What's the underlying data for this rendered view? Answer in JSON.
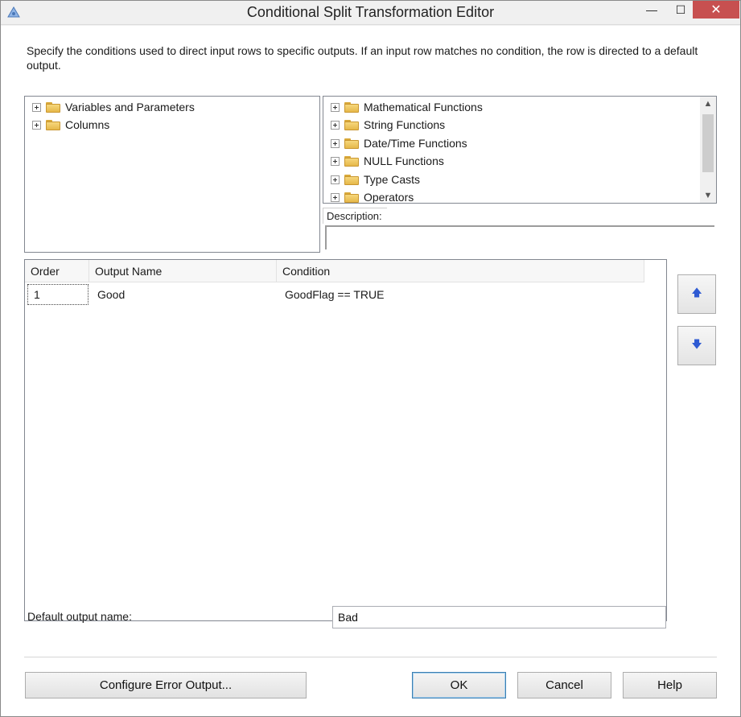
{
  "window": {
    "title": "Conditional Split Transformation Editor",
    "controls": {
      "minimize": "—",
      "maximize": "☐",
      "close": "✕"
    }
  },
  "instructions": "Specify the conditions used to direct input rows to specific outputs. If an input row matches no condition, the row is directed to a default output.",
  "left_tree": {
    "items": [
      {
        "label": "Variables and Parameters",
        "icon": "folder-icon"
      },
      {
        "label": "Columns",
        "icon": "folder-icon"
      }
    ]
  },
  "right_tree": {
    "items": [
      {
        "label": "Mathematical Functions",
        "icon": "folder-icon"
      },
      {
        "label": "String Functions",
        "icon": "folder-icon"
      },
      {
        "label": "Date/Time Functions",
        "icon": "folder-icon"
      },
      {
        "label": "NULL Functions",
        "icon": "folder-icon"
      },
      {
        "label": "Type Casts",
        "icon": "folder-icon"
      },
      {
        "label": "Operators",
        "icon": "folder-icon"
      }
    ]
  },
  "description": {
    "label": "Description:",
    "value": ""
  },
  "grid": {
    "columns": [
      "Order",
      "Output Name",
      "Condition"
    ],
    "rows": [
      {
        "order": "1",
        "output_name": "Good",
        "condition": "GoodFlag ==  TRUE"
      }
    ]
  },
  "default_output": {
    "label": "Default output name:",
    "value": "Bad"
  },
  "buttons": {
    "configure_error": "Configure Error Output...",
    "ok": "OK",
    "cancel": "Cancel",
    "help": "Help"
  },
  "colors": {
    "accent": "#2f5bd3",
    "close_button": "#c75050",
    "ok_border": "#3c7fb1"
  }
}
